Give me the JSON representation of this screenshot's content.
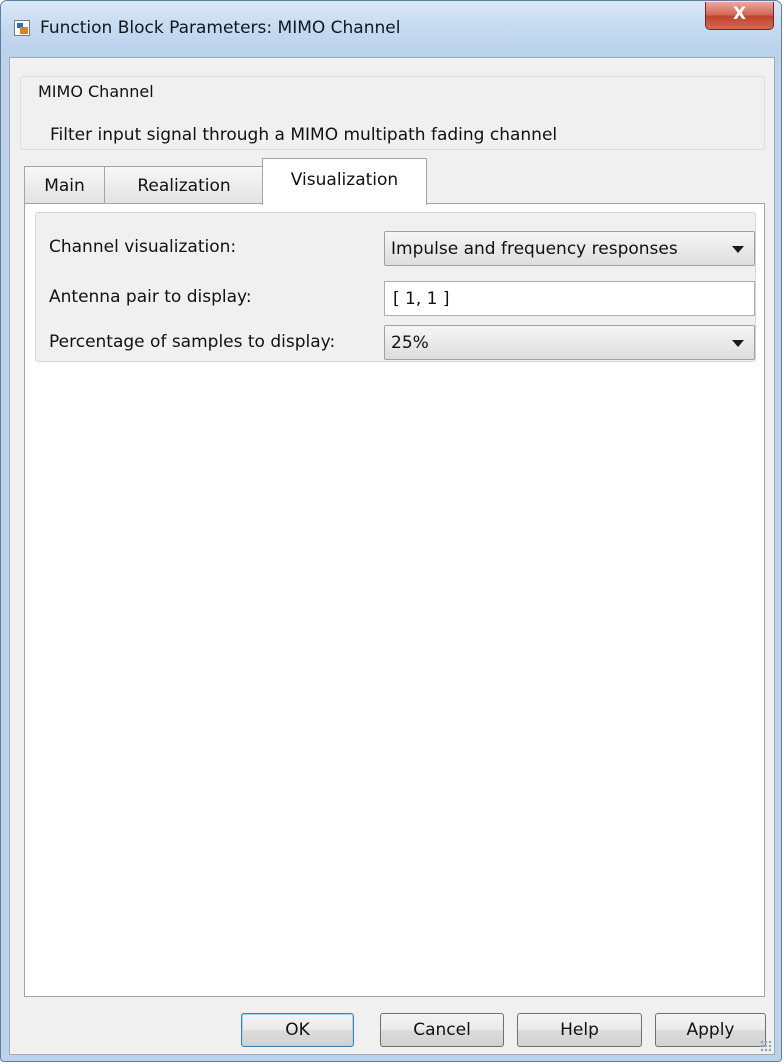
{
  "window": {
    "title": "Function Block Parameters: MIMO Channel",
    "close_label": "X"
  },
  "block": {
    "name": "MIMO Channel",
    "description": "Filter input signal through a MIMO multipath fading channel"
  },
  "tabs": [
    {
      "label": "Main",
      "active": false
    },
    {
      "label": "Realization",
      "active": false
    },
    {
      "label": "Visualization",
      "active": true
    }
  ],
  "params": {
    "channel_visualization": {
      "label": "Channel visualization:",
      "value": "Impulse and frequency responses"
    },
    "antenna_pair": {
      "label": "Antenna pair to display:",
      "value": "[ 1, 1 ]"
    },
    "percentage_samples": {
      "label": "Percentage of samples to display:",
      "value": "25%"
    }
  },
  "buttons": {
    "ok": "OK",
    "cancel": "Cancel",
    "help": "Help",
    "apply": "Apply"
  },
  "icons": {
    "window": "simulink-block-icon",
    "close": "close-icon",
    "dropdown": "chevron-down-icon"
  },
  "colors": {
    "titlebar": "#c5daf0",
    "close_button": "#c8503a",
    "dialog_bg": "#f0f0f0",
    "default_button_border": "#3c7fb1"
  }
}
